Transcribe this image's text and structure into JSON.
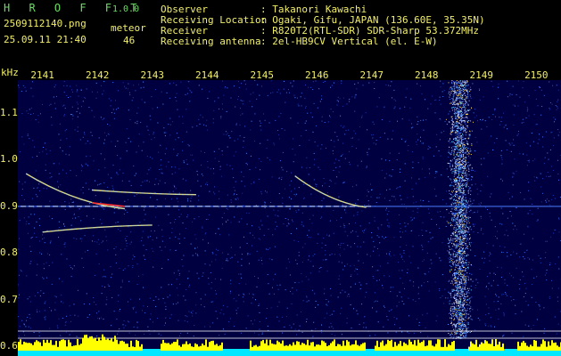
{
  "header": {
    "app_name": "H R O F F T",
    "version": "1.0.0",
    "filename": "2509112140.png",
    "datetime": "25.09.11 21:40",
    "counter_label": "meteor",
    "counter_value": "46",
    "info_labels": [
      "Observer",
      "Receiving Location",
      "Receiver",
      "Receiving antenna"
    ],
    "info_values": [
      ": Takanori Kawachi",
      ": Ogaki, Gifu, JAPAN (136.60E, 35.35N)",
      ": R820T2(RTL-SDR) SDR-Sharp 53.372MHz",
      ": 2el-HB9CV Vertical (el. E-W)"
    ]
  },
  "chart_data": {
    "type": "heatmap",
    "title": "",
    "x_tick_labels": [
      "2141",
      "2142",
      "2143",
      "2144",
      "2145",
      "2146",
      "2147",
      "2148",
      "2149",
      "2150"
    ],
    "y_unit_label": "kHz",
    "y_tick_labels": [
      "1.1",
      "1.0",
      "0.9",
      "0.8",
      "0.7",
      "0.6"
    ],
    "y_ticks": [
      1.1,
      1.0,
      0.9,
      0.8,
      0.7,
      0.6
    ],
    "x_range": [
      2140.55,
      2150.45
    ],
    "y_range": [
      0.58,
      1.17
    ],
    "carrier_kHz": 0.9,
    "meteor_echoes": [
      {
        "x_start": 2140.7,
        "x_end": 2142.5,
        "y_start": 0.97,
        "y_end": 0.895
      },
      {
        "x_start": 2141.9,
        "x_end": 2143.8,
        "y_start": 0.935,
        "y_end": 0.925
      },
      {
        "x_start": 2141.0,
        "x_end": 2143.0,
        "y_start": 0.845,
        "y_end": 0.86
      },
      {
        "x_start": 2145.6,
        "x_end": 2146.9,
        "y_start": 0.965,
        "y_end": 0.898
      }
    ],
    "interference_band": {
      "x_center": 2148.6,
      "width": 0.25
    },
    "colors": {
      "background": "#000040",
      "noise": "#1a3dbf",
      "echo": "#e0e0ff",
      "strong": "#ff3030",
      "bar": "#ffff00",
      "floor": "#00e8ff"
    }
  }
}
